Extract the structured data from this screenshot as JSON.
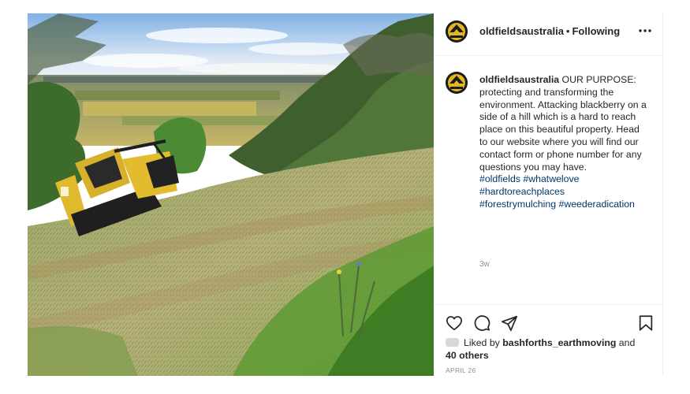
{
  "post": {
    "username": "oldfieldsaustralia",
    "follow_status": "Following",
    "header_separator": "•",
    "caption": {
      "username": "oldfieldsaustralia",
      "text": " OUR PURPOSE: protecting and transforming the environment. Attacking blackberry on a side of a hill which is a hard to reach place on this beautiful property. Head to our website where you will find our contact form or phone number for any questions you may have.",
      "hashtags": [
        "#oldfields",
        "#whatwelove",
        "#hardtoreachplaces",
        "#forestrymulching",
        "#weederadication"
      ]
    },
    "time_ago": "3w",
    "likes": {
      "prefix": "Liked by ",
      "user": "bashforths_earthmoving",
      "and": " and",
      "others": "40 others"
    },
    "date": "APRIL 26"
  },
  "icons": [
    "more-options-icon",
    "heart-icon",
    "comment-icon",
    "share-icon",
    "bookmark-icon"
  ],
  "colors": {
    "hashtag": "#00376b",
    "text": "#262626",
    "muted": "#8e8e8e",
    "divider": "#efefef",
    "avatar_gold": "#e2b71f"
  }
}
